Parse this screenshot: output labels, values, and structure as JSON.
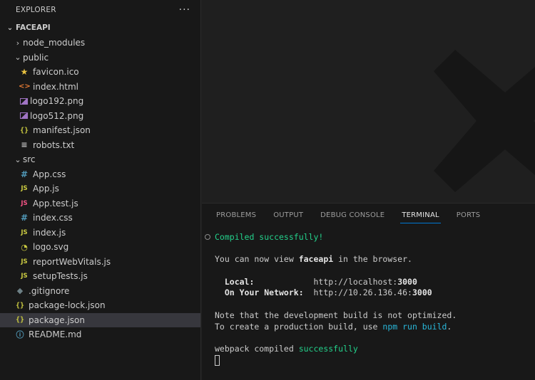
{
  "explorer": {
    "title": "EXPLORER",
    "more": "···",
    "root": "FACEAPI"
  },
  "tree": {
    "node_modules": "node_modules",
    "public": "public",
    "public_files": {
      "favicon": "favicon.ico",
      "index_html": "index.html",
      "logo192": "logo192.png",
      "logo512": "logo512.png",
      "manifest": "manifest.json",
      "robots": "robots.txt"
    },
    "src": "src",
    "src_files": {
      "app_css": "App.css",
      "app_js": "App.js",
      "app_test": "App.test.js",
      "index_css": "index.css",
      "index_js": "index.js",
      "logo_svg": "logo.svg",
      "report": "reportWebVitals.js",
      "setup": "setupTests.js"
    },
    "gitignore": ".gitignore",
    "package_lock": "package-lock.json",
    "package_json": "package.json",
    "readme": "README.md"
  },
  "icons": {
    "html": "<>",
    "json": "{}",
    "css": "#",
    "js": "JS"
  },
  "panel": {
    "tabs": [
      "PROBLEMS",
      "OUTPUT",
      "DEBUG CONSOLE",
      "TERMINAL",
      "PORTS"
    ],
    "active_tab": "TERMINAL"
  },
  "terminal": {
    "compiled": "Compiled successfully!",
    "view_pre": "You can now view ",
    "app_name": "faceapi",
    "view_post": " in the browser.",
    "local_label": "  Local:            ",
    "local_url": "http://localhost:",
    "local_port": "3000",
    "network_label": "  On Your Network:  ",
    "network_url": "http://10.26.136.46:",
    "network_port": "3000",
    "note1": "Note that the development build is not optimized.",
    "note2_pre": "To create a production build, use ",
    "note2_cmd": "npm run build",
    "note2_post": ".",
    "webpack_pre": "webpack compiled ",
    "webpack_status": "successfully"
  },
  "colors": {
    "accent": "#0078d4",
    "success": "#23d18b",
    "link": "#29b8db"
  }
}
